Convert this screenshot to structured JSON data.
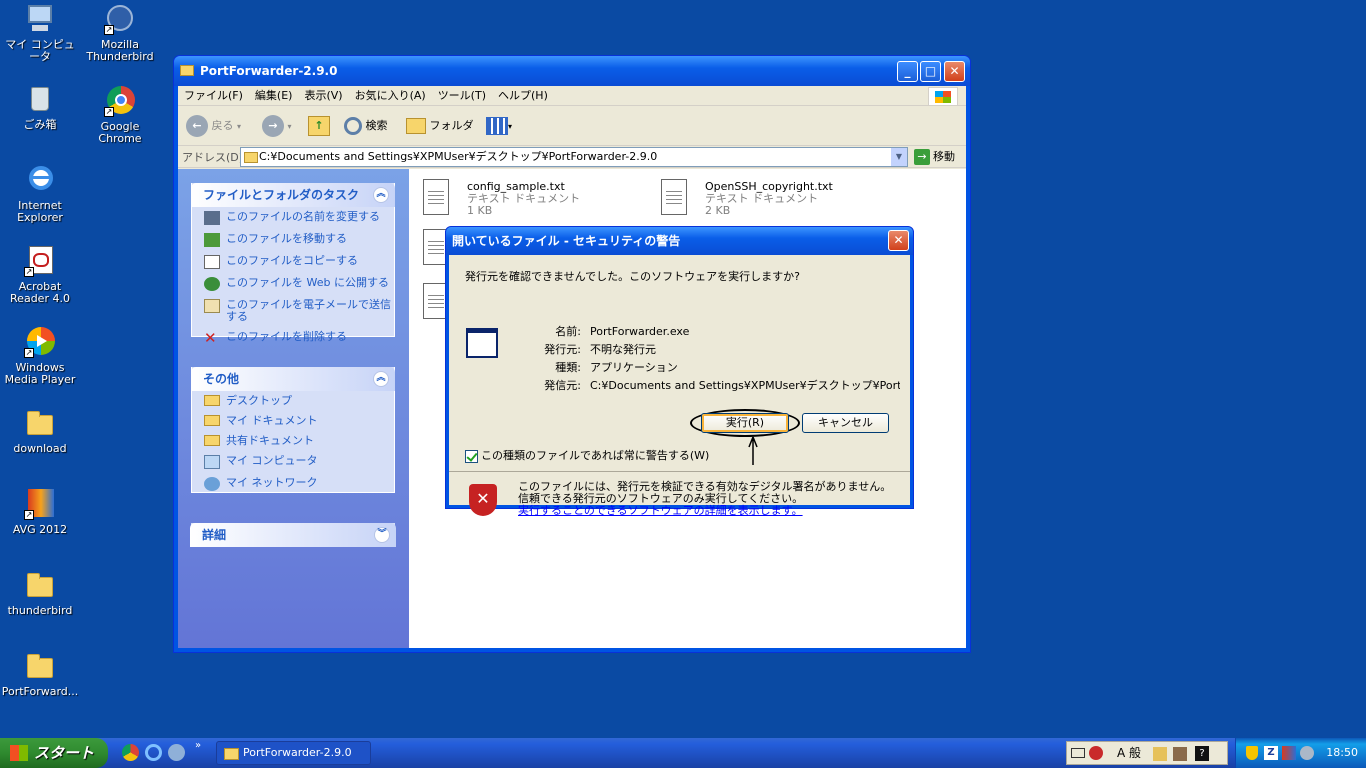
{
  "desktop": {
    "icons": [
      {
        "label": "マイ コンピュータ"
      },
      {
        "label": "Mozilla Thunderbird"
      },
      {
        "label": "ごみ箱"
      },
      {
        "label": "Google Chrome"
      },
      {
        "label": "Internet Explorer"
      },
      {
        "label": "Acrobat Reader 4.0"
      },
      {
        "label": "Windows Media Player"
      },
      {
        "label": "download"
      },
      {
        "label": "AVG 2012"
      },
      {
        "label": "thunderbird"
      },
      {
        "label": "PortForward..."
      }
    ]
  },
  "explorer": {
    "title": "PortForwarder-2.9.0",
    "menu": [
      "ファイル(F)",
      "編集(E)",
      "表示(V)",
      "お気に入り(A)",
      "ツール(T)",
      "ヘルプ(H)"
    ],
    "toolbar": {
      "back": "戻る",
      "search": "検索",
      "folder": "フォルダ"
    },
    "address": {
      "label": "アドレス(D)",
      "value": "C:¥Documents and Settings¥XPMUser¥デスクトップ¥PortForwarder-2.9.0",
      "go": "移動"
    },
    "tasks": {
      "header": "ファイルとフォルダのタスク",
      "items": [
        "このファイルの名前を変更する",
        "このファイルを移動する",
        "このファイルをコピーする",
        "このファイルを Web に公開する",
        "このファイルを電子メールで送信する",
        "このファイルを削除する"
      ]
    },
    "other": {
      "header": "その他",
      "items": [
        "デスクトップ",
        "マイ ドキュメント",
        "共有ドキュメント",
        "マイ コンピュータ",
        "マイ ネットワーク"
      ]
    },
    "details": {
      "header": "詳細"
    },
    "files": [
      {
        "name": "config_sample.txt",
        "type": "テキスト ドキュメント",
        "size": "1 KB"
      },
      {
        "name": "OpenSSH_copyright.txt",
        "type": "テキスト ドキュメント",
        "size": "2 KB"
      }
    ]
  },
  "dialog": {
    "title": "開いているファイル - セキュリティの警告",
    "question": "発行元を確認できませんでした。このソフトウェアを実行しますか?",
    "fields": [
      {
        "key": "名前:",
        "value": "PortForwarder.exe"
      },
      {
        "key": "発行元:",
        "value": "不明な発行元"
      },
      {
        "key": "種類:",
        "value": "アプリケーション"
      },
      {
        "key": "発信元:",
        "value": "C:¥Documents and Settings¥XPMUser¥デスクトップ¥PortFo..."
      }
    ],
    "run_button": "実行(R)",
    "cancel_button": "キャンセル",
    "checkbox_label": "この種類のファイルであれば常に警告する(W)",
    "checkbox_checked": true,
    "warning_text": "このファイルには、発行元を検証できる有効なデジタル署名がありません。信頼できる発行元のソフトウェアのみ実行してください。",
    "warning_link": "実行することのできるソフトウェアの詳細を表示します。"
  },
  "taskbar": {
    "start": "スタート",
    "task_button": "PortForwarder-2.9.0",
    "ime_text": "A 般",
    "clock": "18:50"
  }
}
